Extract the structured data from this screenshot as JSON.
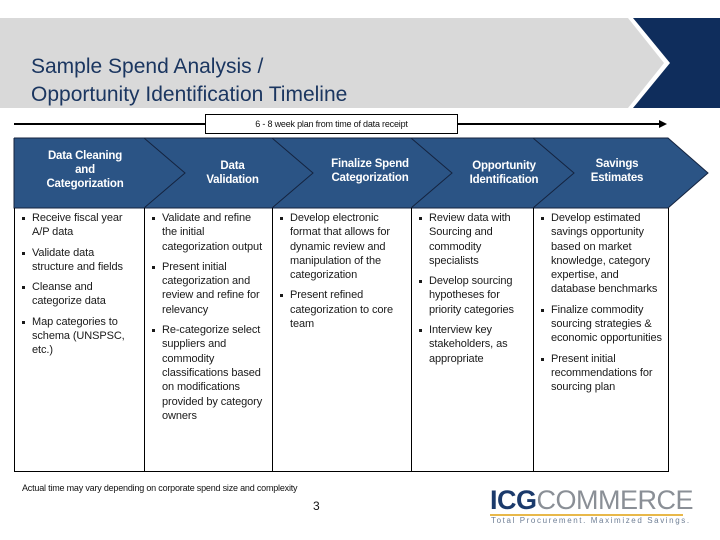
{
  "header": {
    "title_lines": [
      "Sample Spend Analysis /",
      "Opportunity Identification Timeline"
    ]
  },
  "colors": {
    "banner_gray": "#d9d9d9",
    "banner_navy": "#0f2d5c",
    "band_blue": "#2b5485",
    "band_line": "#14233f",
    "title_text": "#1b3660"
  },
  "timeline": {
    "label": "6 - 8 week plan from time of data receipt"
  },
  "phases": [
    {
      "title_lines": [
        "Data Cleaning",
        "and",
        "Categorization"
      ],
      "bullets": [
        "Receive fiscal year A/P data",
        "Validate data structure and fields",
        "Cleanse and categorize data",
        "Map categories to schema (UNSPSC, etc.)"
      ]
    },
    {
      "title_lines": [
        "Data",
        "Validation"
      ],
      "bullets": [
        "Validate and refine the initial categorization output",
        "Present initial categorization and review and refine for relevancy",
        "Re-categorize select suppliers and commodity classifications based on modifications provided by category owners"
      ]
    },
    {
      "title_lines": [
        "Finalize Spend",
        "Categorization"
      ],
      "bullets": [
        "Develop electronic format that allows for dynamic review and manipulation of the categorization",
        "Present refined categorization to core team"
      ]
    },
    {
      "title_lines": [
        "Opportunity",
        "Identification"
      ],
      "bullets": [
        "Review data with Sourcing and commodity specialists",
        "Develop sourcing hypotheses for priority categories",
        "Interview key stakeholders, as appropriate"
      ]
    },
    {
      "title_lines": [
        "Savings",
        "Estimates"
      ],
      "bullets": [
        "Develop estimated savings opportunity based on market knowledge, category expertise, and database benchmarks",
        "Finalize commodity sourcing strategies & economic opportunities",
        "Present initial recommendations for sourcing plan"
      ]
    }
  ],
  "footer": {
    "note": "Actual time may vary depending on corporate spend size and complexity",
    "page_number": "3"
  },
  "logo": {
    "word_bold": "ICG",
    "word_light": "COMMERCE",
    "tagline": "Total Procurement. Maximized Savings."
  }
}
